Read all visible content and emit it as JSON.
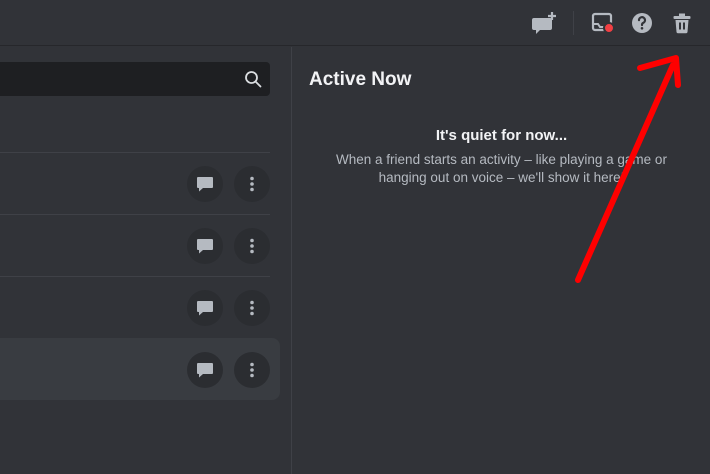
{
  "header": {
    "icons": [
      "new-group-dm-icon",
      "inbox-icon",
      "help-icon",
      "trash-icon"
    ],
    "inbox_badge_color": "#f23f43"
  },
  "search": {
    "value": "",
    "placeholder": ""
  },
  "friends_rows": [
    {
      "actions": [
        "message-icon",
        "more-icon"
      ]
    },
    {
      "actions": [
        "message-icon",
        "more-icon"
      ]
    },
    {
      "actions": [
        "message-icon",
        "more-icon"
      ]
    },
    {
      "actions": [
        "message-icon",
        "more-icon"
      ],
      "hovered": true
    }
  ],
  "active_now": {
    "title": "Active Now",
    "empty_title": "It's quiet for now...",
    "empty_description": "When a friend starts an activity – like playing a game or hanging out on voice – we'll show it here!"
  },
  "annotation": {
    "arrow_color": "#ff0000"
  }
}
